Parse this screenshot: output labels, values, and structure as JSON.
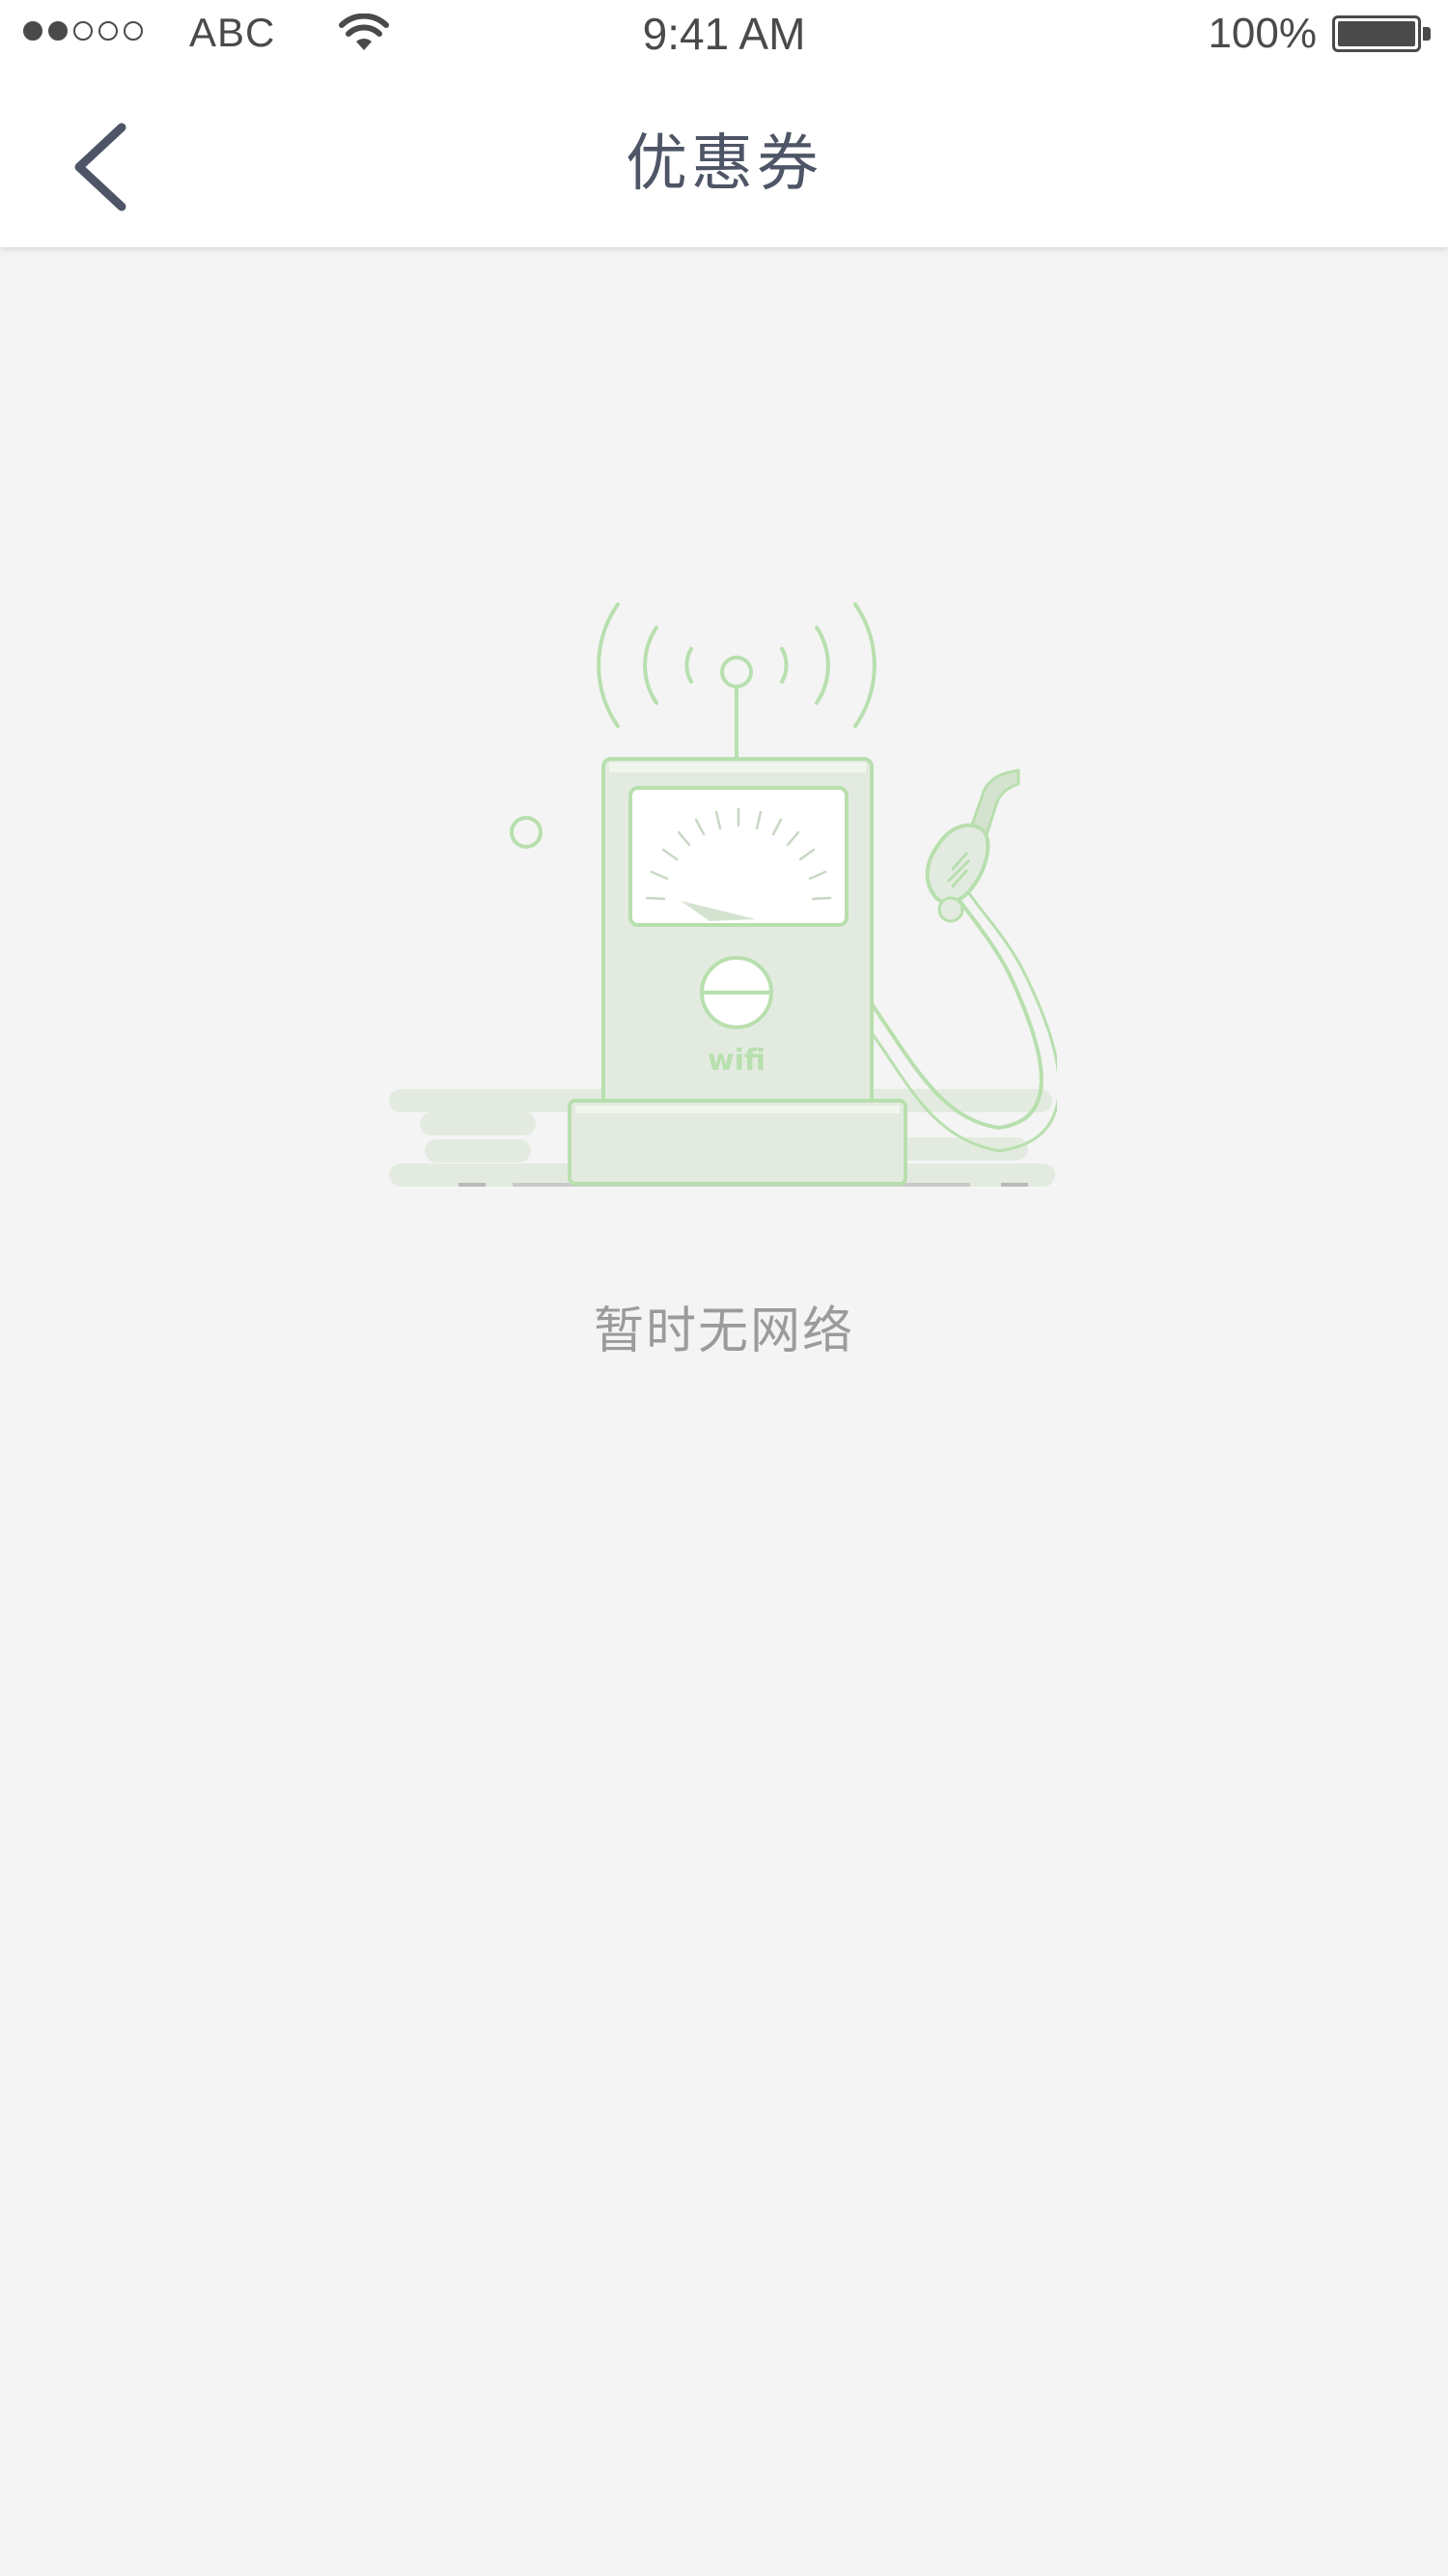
{
  "status_bar": {
    "carrier": "ABC",
    "time": "9:41 AM",
    "battery": "100%",
    "signal_filled": 2,
    "signal_total": 5
  },
  "nav": {
    "title": "优惠券",
    "back_icon": "chevron-left-icon"
  },
  "empty_state": {
    "message": "暂时无网络",
    "illustration_label": "wifi",
    "accent_color": "#b8dfae"
  },
  "colors": {
    "background": "#f4f4f4",
    "header": "#ffffff",
    "title": "#4e5566",
    "message": "#9b9b9b"
  }
}
